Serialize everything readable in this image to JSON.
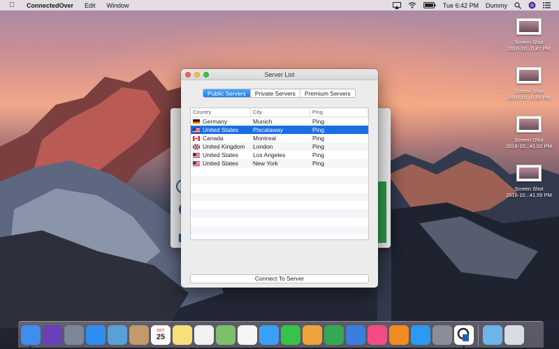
{
  "menubar": {
    "app_name": "ConnectedOver",
    "menus": [
      "Edit",
      "Window"
    ],
    "clock": "Tue 6:42 PM",
    "user": "Dummy"
  },
  "desktop_icons": [
    {
      "line1": "Screen Shot",
      "line2": "2016-10...0.47 PM"
    },
    {
      "line1": "Screen Shot",
      "line2": "2016-10...0.55 PM"
    },
    {
      "line1": "Screen Shot",
      "line2": "2016-10...41.02 PM"
    },
    {
      "line1": "Screen Shot",
      "line2": "2016-10...41.55 PM"
    }
  ],
  "window": {
    "title": "Server List",
    "tabs": [
      {
        "label": "Public Servers",
        "active": true
      },
      {
        "label": "Private Servers",
        "active": false
      },
      {
        "label": "Premium Servers",
        "active": false
      }
    ],
    "table": {
      "columns": [
        "Country",
        "City",
        "Ping"
      ],
      "rows": [
        {
          "country": "Germany",
          "city": "Munich",
          "ping": "Ping",
          "flag": "de",
          "selected": false
        },
        {
          "country": "United States",
          "city": "Piscataway",
          "ping": "Ping",
          "flag": "us",
          "selected": true
        },
        {
          "country": "Canada",
          "city": "Montreal",
          "ping": "Ping",
          "flag": "ca",
          "selected": false
        },
        {
          "country": "United Kingdom",
          "city": "London",
          "ping": "Ping",
          "flag": "uk",
          "selected": false
        },
        {
          "country": "United States",
          "city": "Los Angeles",
          "ping": "Ping",
          "flag": "us",
          "selected": false
        },
        {
          "country": "United States",
          "city": "New York",
          "ping": "Ping",
          "flag": "us",
          "selected": false
        }
      ]
    },
    "connect_label": "Connect To Server"
  },
  "dock": {
    "calendar_day": "25",
    "calendar_month": "OCT",
    "items": [
      {
        "name": "finder-icon",
        "color": "#3d8ef0",
        "running": true
      },
      {
        "name": "siri-icon",
        "color": "#6b3fb8",
        "running": false
      },
      {
        "name": "launchpad-icon",
        "color": "#7a8899",
        "running": false
      },
      {
        "name": "safari-icon",
        "color": "#2f8ff0",
        "running": false
      },
      {
        "name": "preview-photo-icon",
        "color": "#5aa0d8",
        "running": false
      },
      {
        "name": "contacts-icon",
        "color": "#c29b68",
        "running": false
      },
      {
        "name": "calendar-icon",
        "color": "#ffffff",
        "running": false
      },
      {
        "name": "notes-icon",
        "color": "#f7e07a",
        "running": false
      },
      {
        "name": "reminders-icon",
        "color": "#f2f2f2",
        "running": false
      },
      {
        "name": "maps-icon",
        "color": "#7dc06a",
        "running": false
      },
      {
        "name": "photos-icon",
        "color": "#f5f5f5",
        "running": false
      },
      {
        "name": "messages-icon",
        "color": "#3aa0f7",
        "running": false
      },
      {
        "name": "facetime-icon",
        "color": "#37c24c",
        "running": false
      },
      {
        "name": "pages-icon",
        "color": "#f0a33a",
        "running": false
      },
      {
        "name": "numbers-icon",
        "color": "#35a853",
        "running": false
      },
      {
        "name": "keynote-icon",
        "color": "#3b7ee0",
        "running": false
      },
      {
        "name": "itunes-icon",
        "color": "#f14c83",
        "running": false
      },
      {
        "name": "ibooks-icon",
        "color": "#f28b1f",
        "running": false
      },
      {
        "name": "app-store-icon",
        "color": "#2b9af3",
        "running": false
      },
      {
        "name": "system-preferences-icon",
        "color": "#8a8f96",
        "running": false
      },
      {
        "name": "connectedover-app-icon",
        "color": "#ffffff",
        "running": true
      }
    ]
  }
}
